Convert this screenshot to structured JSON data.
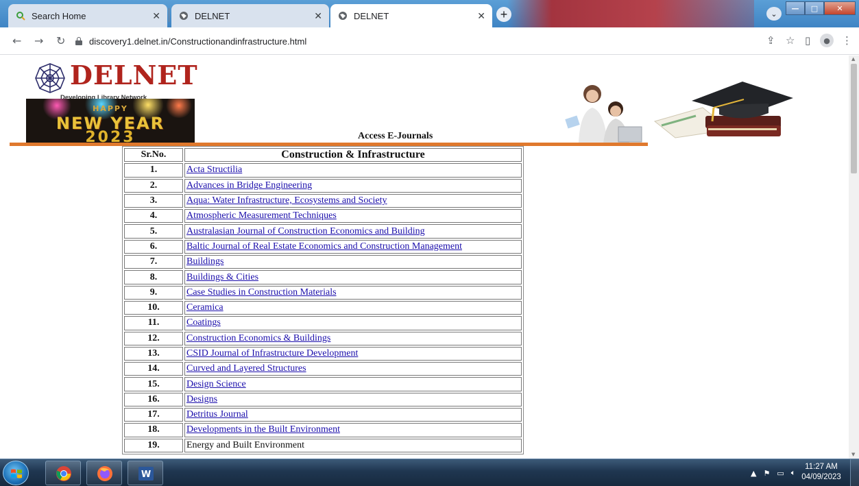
{
  "browser": {
    "tabs": [
      {
        "title": "Search Home",
        "icon": "search-home-icon",
        "active": false
      },
      {
        "title": "DELNET",
        "icon": "globe-icon",
        "active": false
      },
      {
        "title": "DELNET",
        "icon": "globe-icon",
        "active": true
      }
    ],
    "url": "discovery1.delnet.in/Constructionandinfrastructure.html"
  },
  "header": {
    "logo_text": "DELNET",
    "logo_tagline": "Developing Library Network",
    "banner": {
      "line1": "HAPPY",
      "line2": "NEW YEAR",
      "line3": "2023"
    },
    "page_heading": "Access E-Journals",
    "accent_color": "#e0792d"
  },
  "table": {
    "col_serial": "Sr.No.",
    "col_title": "Construction & Infrastructure",
    "rows": [
      {
        "no": "1.",
        "title": "Acta Structilia"
      },
      {
        "no": "2.",
        "title": "Advances in Bridge Engineering"
      },
      {
        "no": "3.",
        "title": "Aqua: Water Infrastructure, Ecosystems and Society"
      },
      {
        "no": "4.",
        "title": "Atmospheric Measurement Techniques"
      },
      {
        "no": "5.",
        "title": "Australasian Journal of Construction Economics and Building"
      },
      {
        "no": "6.",
        "title": "Baltic Journal of Real Estate Economics and Construction Management"
      },
      {
        "no": "7.",
        "title": "Buildings"
      },
      {
        "no": "8.",
        "title": "Buildings & Cities"
      },
      {
        "no": "9.",
        "title": "Case Studies in Construction Materials"
      },
      {
        "no": "10.",
        "title": "Ceramica"
      },
      {
        "no": "11.",
        "title": "Coatings"
      },
      {
        "no": "12.",
        "title": "Construction Economics & Buildings"
      },
      {
        "no": "13.",
        "title": "CSID Journal of Infrastructure Development"
      },
      {
        "no": "14.",
        "title": "Curved and Layered Structures"
      },
      {
        "no": "15.",
        "title": "Design Science"
      },
      {
        "no": "16.",
        "title": "Designs"
      },
      {
        "no": "17.",
        "title": "Detritus Journal"
      },
      {
        "no": "18.",
        "title": "Developments in the Built Environment"
      },
      {
        "no": "19.",
        "title": "Energy and Built Environment"
      }
    ],
    "link_color": "#1a0dab"
  },
  "taskbar": {
    "apps": [
      "chrome-icon",
      "firefox-icon",
      "word-icon"
    ],
    "time": "11:27 AM",
    "date": "04/09/2023"
  }
}
